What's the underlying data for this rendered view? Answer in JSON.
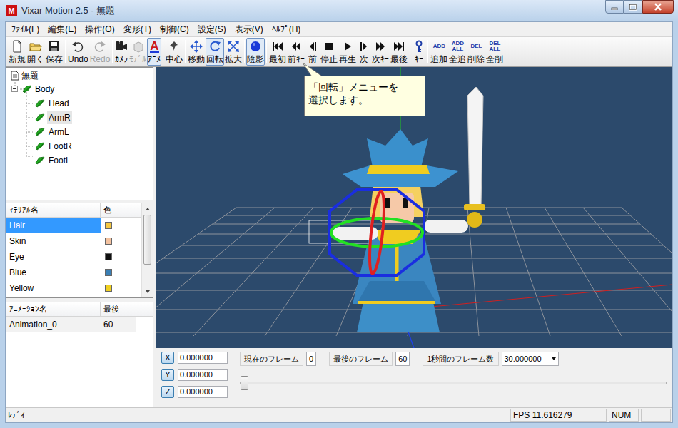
{
  "window": {
    "title": "Vixar Motion 2.5 - 無題",
    "app_icon_text": "M"
  },
  "menu": [
    "ﾌｧｲﾙ(F)",
    "編集(E)",
    "操作(O)",
    "変形(T)",
    "制御(C)",
    "設定(S)",
    "表示(V)",
    "ﾍﾙﾌﾟ(H)"
  ],
  "toolbar": {
    "groups": [
      {
        "items": [
          {
            "label": "新規",
            "selected": false,
            "disabled": false
          },
          {
            "label": "開く",
            "selected": false,
            "disabled": false
          },
          {
            "label": "保存",
            "selected": false,
            "disabled": false
          }
        ]
      },
      {
        "items": [
          {
            "label": "Undo",
            "selected": false,
            "disabled": false
          },
          {
            "label": "Redo",
            "selected": false,
            "disabled": true
          }
        ]
      },
      {
        "items": [
          {
            "label": "ｶﾒﾗ",
            "selected": false,
            "disabled": false
          },
          {
            "label": "ﾓﾃﾞﾙ",
            "selected": false,
            "disabled": true
          },
          {
            "label": "ｱﾆﾒ",
            "selected": true,
            "disabled": false,
            "icon_text": "A"
          }
        ]
      },
      {
        "items": [
          {
            "label": "中心",
            "selected": false,
            "disabled": false
          }
        ]
      },
      {
        "items": [
          {
            "label": "移動",
            "selected": false,
            "disabled": false
          },
          {
            "label": "回転",
            "selected": true,
            "disabled": false
          },
          {
            "label": "拡大",
            "selected": false,
            "disabled": false
          }
        ]
      },
      {
        "items": [
          {
            "label": "陰影",
            "selected": true,
            "disabled": false
          }
        ]
      },
      {
        "items": [
          {
            "label": "最初",
            "selected": false,
            "disabled": false
          },
          {
            "label": "前ｷｰ",
            "selected": false,
            "disabled": false
          },
          {
            "label": "前",
            "selected": false,
            "disabled": false
          },
          {
            "label": "停止",
            "selected": false,
            "disabled": false
          },
          {
            "label": "再生",
            "selected": false,
            "disabled": false
          },
          {
            "label": "次",
            "selected": false,
            "disabled": false
          },
          {
            "label": "次ｷｰ",
            "selected": false,
            "disabled": false
          },
          {
            "label": "最後",
            "selected": false,
            "disabled": false
          }
        ]
      },
      {
        "items": [
          {
            "label": "ｷｰ",
            "selected": false,
            "disabled": false
          }
        ]
      },
      {
        "items": [
          {
            "label": "追加",
            "selected": false,
            "disabled": false,
            "icon_text": "ADD"
          },
          {
            "label": "全追",
            "selected": false,
            "disabled": false,
            "icon_text": "ADD ALL"
          },
          {
            "label": "削除",
            "selected": false,
            "disabled": false,
            "icon_text": "DEL"
          },
          {
            "label": "全削",
            "selected": false,
            "disabled": false,
            "icon_text": "DEL ALL"
          }
        ]
      }
    ]
  },
  "tooltip": {
    "lines": [
      "「回転」メニューを",
      "選択します。"
    ]
  },
  "tree": {
    "root": "無題",
    "body": {
      "label": "Body",
      "expanded": true
    },
    "items": [
      {
        "label": "Head",
        "selected": false
      },
      {
        "label": "ArmR",
        "selected": true
      },
      {
        "label": "ArmL",
        "selected": false
      },
      {
        "label": "FootR",
        "selected": false
      },
      {
        "label": "FootL",
        "selected": false
      }
    ]
  },
  "materials": {
    "columns": [
      "ﾏﾃﾘｱﾙ名",
      "色"
    ],
    "rows": [
      {
        "name": "Hair",
        "color": "#f5c842",
        "selected": true
      },
      {
        "name": "Skin",
        "color": "#f4c2a0",
        "selected": false
      },
      {
        "name": "Eye",
        "color": "#101010",
        "selected": false
      },
      {
        "name": "Blue",
        "color": "#3a7fb5",
        "selected": false
      },
      {
        "name": "Yellow",
        "color": "#f0d020",
        "selected": false
      }
    ]
  },
  "animations": {
    "columns": [
      "ｱﾆﾒｰｼｮﾝ名",
      "最後"
    ],
    "rows": [
      {
        "name": "Animation_0",
        "last": "60",
        "selected": false
      }
    ]
  },
  "coords": [
    {
      "axis": "X",
      "value": "0.000000"
    },
    {
      "axis": "Y",
      "value": "0.000000"
    },
    {
      "axis": "Z",
      "value": "0.000000"
    }
  ],
  "frames": {
    "current_label": "現在のフレーム",
    "current": "0",
    "last_label": "最後のフレーム",
    "last": "60",
    "fps_label": "1秒間のフレーム数",
    "fps": "30.000000"
  },
  "timeline": {
    "level": 0
  },
  "status_bar": {
    "text": "ﾚﾃﾞｨ",
    "fps": "FPS 11.616279",
    "num": "NUM"
  }
}
